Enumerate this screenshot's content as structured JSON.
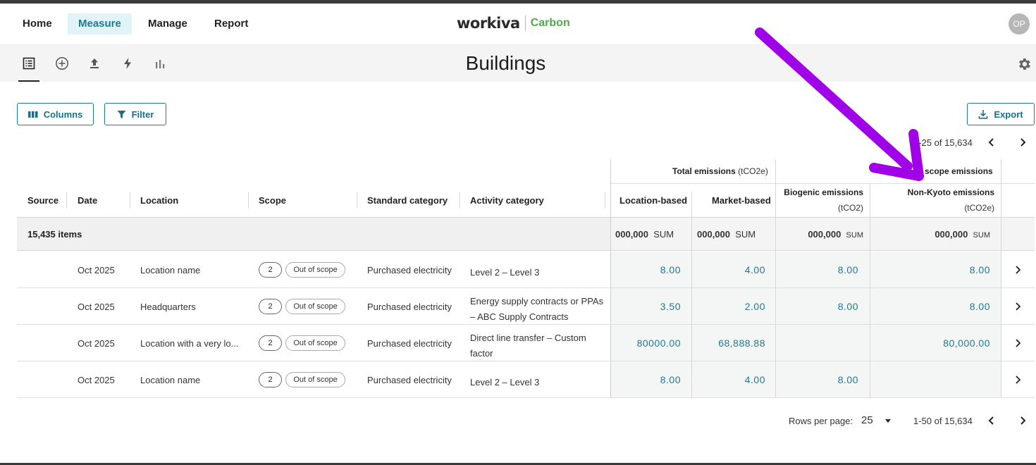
{
  "nav": {
    "items": [
      {
        "label": "Home"
      },
      {
        "label": "Measure"
      },
      {
        "label": "Manage"
      },
      {
        "label": "Report"
      }
    ],
    "brand": {
      "name": "workiva",
      "product": "Carbon"
    },
    "avatar_initials": "OP"
  },
  "toolbar": {
    "icons": [
      "list-view-icon",
      "add-circle-icon",
      "upload-icon",
      "bolt-icon",
      "bar-chart-icon"
    ],
    "title": "Buildings"
  },
  "actions": {
    "columns_label": "Columns",
    "filter_label": "Filter",
    "export_label": "Export",
    "page_range_top": "1-25 of 15,634"
  },
  "table": {
    "group_total": "Total emissions",
    "group_total_unit": "(tCO2e)",
    "group_scope": "scope emissions",
    "columns": {
      "source": "Source",
      "date": "Date",
      "location": "Location",
      "scope": "Scope",
      "standard_category": "Standard category",
      "activity_category": "Activity category",
      "location_based": "Location-based",
      "market_based": "Market-based",
      "biogenic": "Biogenic emissions",
      "biogenic_unit": "(tCO2)",
      "non_kyoto": "Non-Kyoto emissions",
      "non_kyoto_unit": "(tCO2e)"
    },
    "summary": {
      "items": "15,435 items",
      "location_based": "000,000",
      "market_based": "000,000",
      "biogenic": "000,000",
      "non_kyoto": "000,000",
      "sum_label": "SUM"
    },
    "rows": [
      {
        "date": "Oct 2025",
        "location": "Location name",
        "scope": "2",
        "scope_status": "Out of scope",
        "standard_category": "Purchased electricity",
        "activity_line1": "Level 2 – Level 3",
        "activity_line2": "",
        "location_based": "8.00",
        "market_based": "4.00",
        "biogenic": "8.00",
        "non_kyoto": "8.00"
      },
      {
        "date": "Oct 2025",
        "location": "Headquarters",
        "scope": "2",
        "scope_status": "Out of scope",
        "standard_category": "Purchased electricity",
        "activity_line1": "Energy supply contracts or PPAs",
        "activity_line2": "– ABC Supply Contracts",
        "location_based": "3.50",
        "market_based": "2.00",
        "biogenic": "8.00",
        "non_kyoto": "8.00"
      },
      {
        "date": "Oct 2025",
        "location": "Location with a very lo...",
        "scope": "2",
        "scope_status": "Out of scope",
        "standard_category": "Purchased electricity",
        "activity_line1": "Direct line transfer – Custom",
        "activity_line2": "factor",
        "location_based": "80000.00",
        "market_based": "68,888.88",
        "biogenic": "",
        "non_kyoto": "80,000.00"
      },
      {
        "date": "Oct 2025",
        "location": "Location name",
        "scope": "2",
        "scope_status": "Out of scope",
        "standard_category": "Purchased electricity",
        "activity_line1": "Level 2 – Level 3",
        "activity_line2": "",
        "location_based": "8.00",
        "market_based": "4.00",
        "biogenic": "8.00",
        "non_kyoto": ""
      }
    ]
  },
  "footer": {
    "rows_per_page_label": "Rows per page:",
    "rows_per_page_value": "25",
    "page_range": "1-50 of 15,634"
  },
  "colors": {
    "accent": "#1b7a95",
    "brand_green": "#52a84a",
    "annotation_arrow": "#a000e8"
  }
}
